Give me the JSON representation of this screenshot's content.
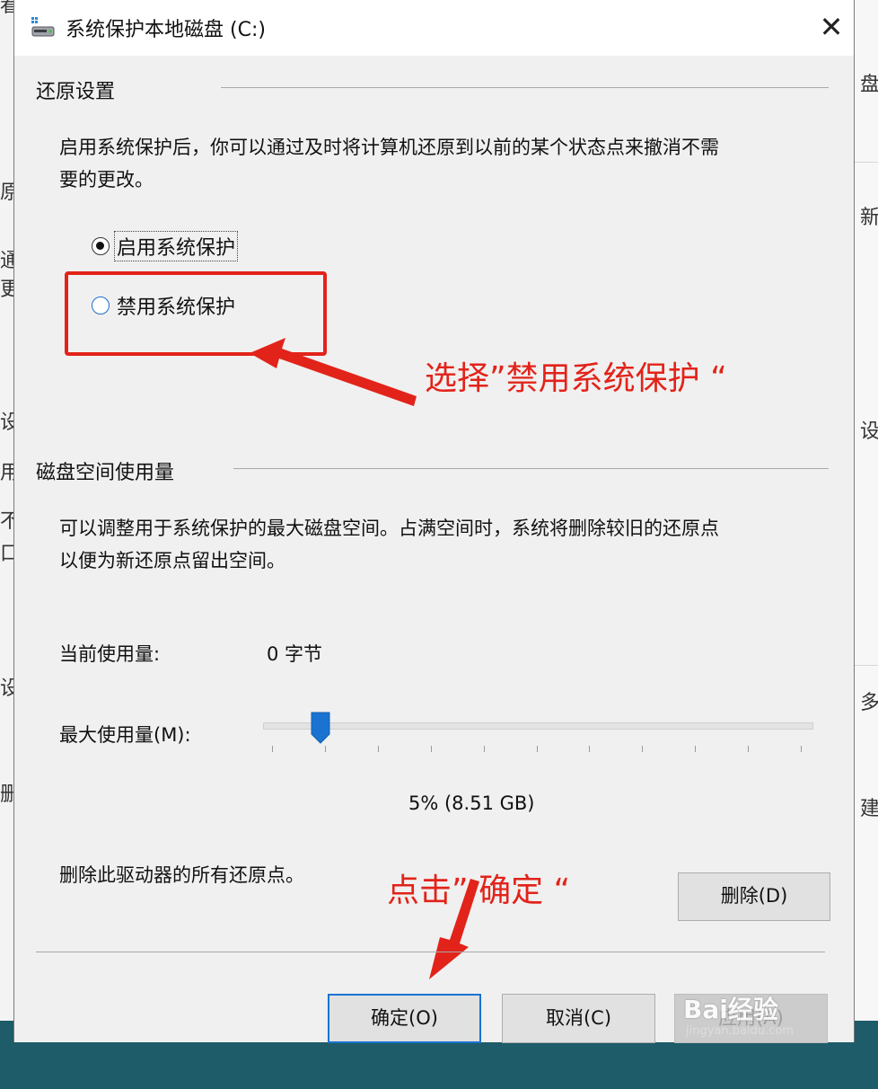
{
  "window": {
    "title": "系统保护本地磁盘 (C:)",
    "close_glyph": "✕"
  },
  "restore_settings": {
    "group_title": "还原设置",
    "description_line1": "启用系统保护后，你可以通过及时将计算机还原到以前的某个状态点来撤消不需",
    "description_line2": "要的更改。",
    "options": [
      {
        "label": "启用系统保护",
        "selected": true
      },
      {
        "label": "禁用系统保护",
        "selected": false
      }
    ]
  },
  "disk_space": {
    "group_title": "磁盘空间使用量",
    "description_line1": "可以调整用于系统保护的最大磁盘空间。占满空间时，系统将删除较旧的还原点",
    "description_line2": "以便为新还原点留出空间。",
    "current_usage_label": "当前使用量:",
    "current_usage_value": "0 字节",
    "max_usage_label": "最大使用量(M):",
    "max_usage_fraction": 0.05,
    "max_usage_value": "5% (8.51 GB)",
    "delete_label": "删除此驱动器的所有还原点。",
    "delete_button": "删除(D)"
  },
  "buttons": {
    "ok": "确定(O)",
    "cancel": "取消(C)",
    "apply": "应用(A)"
  },
  "annotations": {
    "select_disable": "选择”禁用系统保护 “",
    "click_ok": "点击” 确定 “",
    "color": "#e2231a"
  },
  "watermark": {
    "brand": "Bai经验",
    "url": "jingyan.baidu.com"
  },
  "background_fragments": {
    "left": [
      "看",
      "原",
      "通",
      "更",
      "设",
      "用",
      "不",
      "口",
      "设",
      "删"
    ],
    "right": [
      "盘",
      "新",
      "设",
      "多",
      "建"
    ]
  }
}
